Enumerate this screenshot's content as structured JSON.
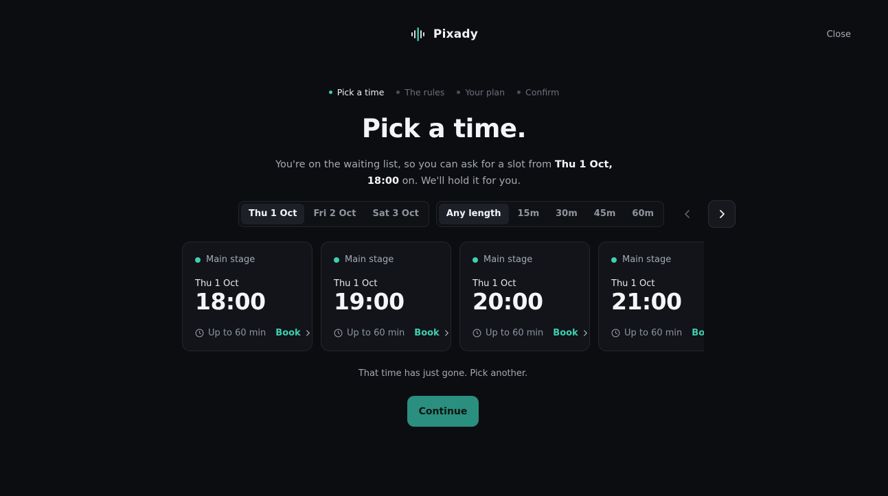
{
  "brand": {
    "name": "Pixady"
  },
  "header": {
    "close_label": "Close"
  },
  "stepper": {
    "steps": [
      {
        "label": "Pick a time"
      },
      {
        "label": "The rules"
      },
      {
        "label": "Your plan"
      },
      {
        "label": "Confirm"
      }
    ]
  },
  "main": {
    "title": "Pick a time.",
    "subtitle_pre": "You're on the waiting list, so you can ask for a slot from ",
    "subtitle_bold1": "Thu 1 Oct,",
    "subtitle_bold2": "18:00",
    "subtitle_post": " on. We'll hold it for you."
  },
  "filters": {
    "days": [
      {
        "label": "Thu 1 Oct"
      },
      {
        "label": "Fri 2 Oct"
      },
      {
        "label": "Sat 3 Oct"
      }
    ],
    "lengths": [
      {
        "label": "Any length"
      },
      {
        "label": "15m"
      },
      {
        "label": "30m"
      },
      {
        "label": "45m"
      },
      {
        "label": "60m"
      }
    ]
  },
  "slots": [
    {
      "stage": "Main stage",
      "date": "Thu 1 Oct",
      "time": "18:00",
      "duration": "Up to 60 min",
      "action": "Book"
    },
    {
      "stage": "Main stage",
      "date": "Thu 1 Oct",
      "time": "19:00",
      "duration": "Up to 60 min",
      "action": "Book"
    },
    {
      "stage": "Main stage",
      "date": "Thu 1 Oct",
      "time": "20:00",
      "duration": "Up to 60 min",
      "action": "Book"
    },
    {
      "stage": "Main stage",
      "date": "Thu 1 Oct",
      "time": "21:00",
      "duration": "Up to 60 min",
      "action": "Book"
    }
  ],
  "error_message": "That time has just gone. Pick another.",
  "continue_label": "Continue",
  "colors": {
    "accent": "#3fcfb0",
    "button": "#2a8f7e",
    "background": "#0c0d10"
  }
}
